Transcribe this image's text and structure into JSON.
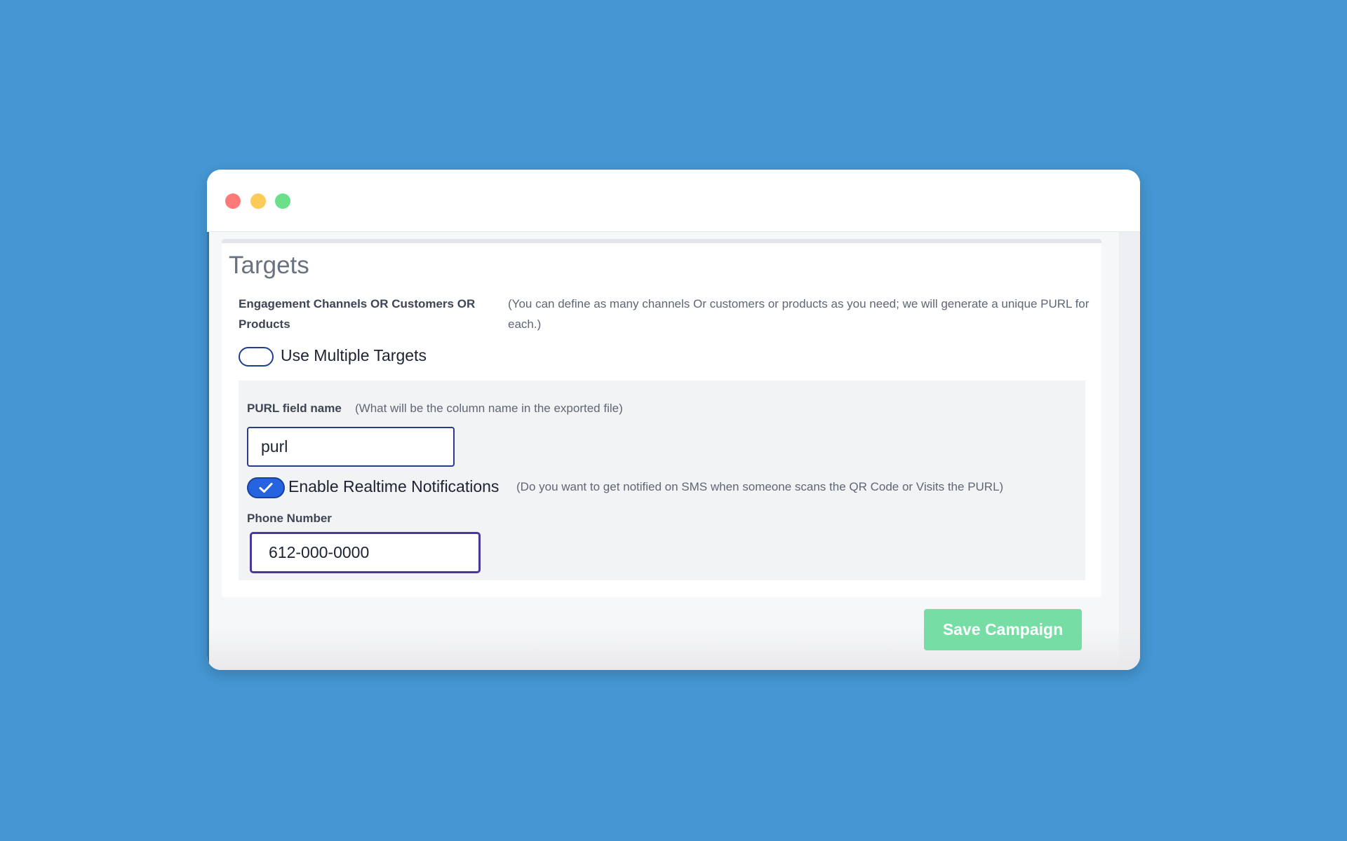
{
  "colors": {
    "background": "#4596d2",
    "window_close": "#fe7a78",
    "window_minimize": "#fdcb57",
    "window_maximize": "#6bdf8a",
    "toggle_on": "#2563e0",
    "save_button": "#76dea4"
  },
  "window": {
    "controls": [
      "close",
      "minimize",
      "maximize"
    ]
  },
  "targets": {
    "title": "Targets",
    "channels_label": "Engagement Channels OR Customers OR Products",
    "channels_help": "(You can define as many channels Or customers or products as you need; we will generate a unique PURL for each.)",
    "multiple_targets": {
      "label": "Use Multiple Targets",
      "enabled": false
    },
    "purl_field": {
      "label": "PURL field name",
      "help": "(What will be the column name in the exported file)",
      "value": "purl"
    },
    "notifications": {
      "label": "Enable Realtime Notifications",
      "help": "(Do you want to get notified on SMS when someone scans the QR Code or Visits the PURL)",
      "enabled": true,
      "icon": "check-icon"
    },
    "phone": {
      "label": "Phone Number",
      "value": "612-000-0000"
    }
  },
  "actions": {
    "save_label": "Save Campaign"
  }
}
